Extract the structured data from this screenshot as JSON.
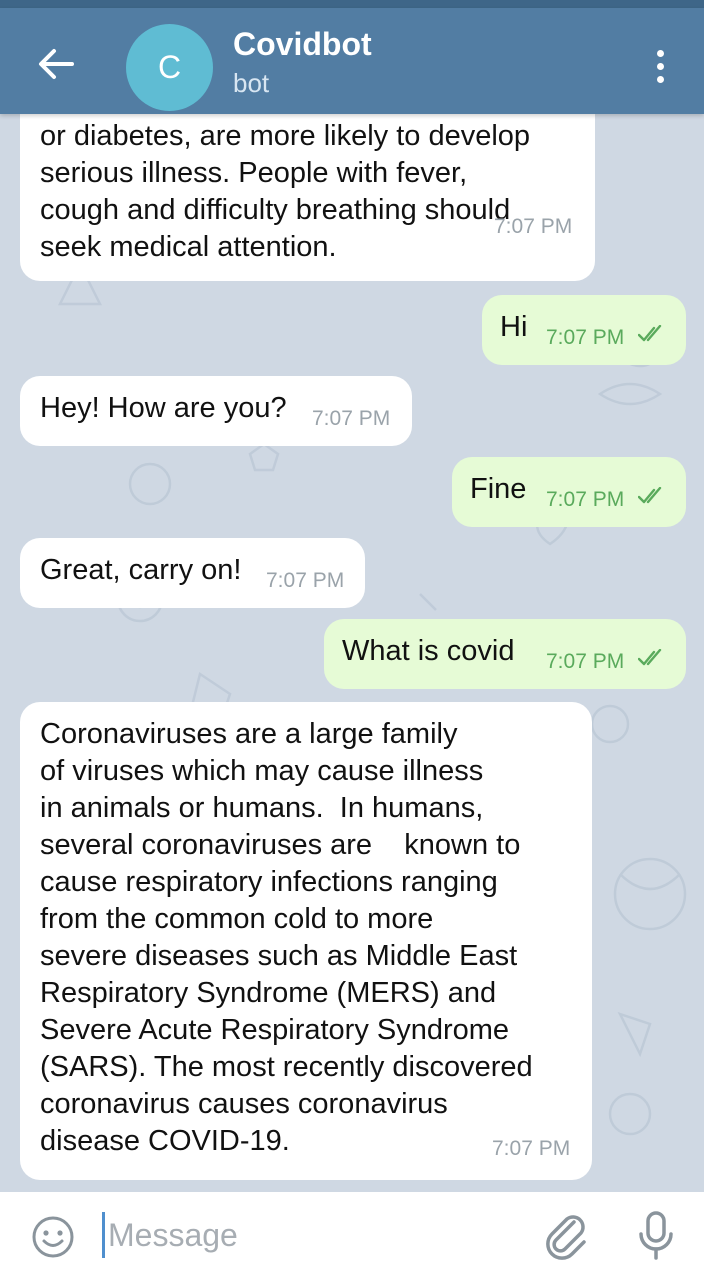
{
  "header": {
    "back_icon": "arrow-left-icon",
    "avatar_letter": "C",
    "avatar_color": "#5fbcd3",
    "title": "Covidbot",
    "subtitle": "bot",
    "menu_icon": "more-vertical-icon",
    "bar_color": "#527da3"
  },
  "messages": [
    {
      "direction": "in",
      "text": "or diabetes, are more likely to develop\nserious illness. People with fever,\ncough and difficulty breathing should\nseek medical attention.",
      "time": "7:07 PM"
    },
    {
      "direction": "out",
      "text": "Hi",
      "time": "7:07 PM",
      "read": true
    },
    {
      "direction": "in",
      "text": "Hey! How are you?",
      "time": "7:07 PM"
    },
    {
      "direction": "out",
      "text": "Fine",
      "time": "7:07 PM",
      "read": true
    },
    {
      "direction": "in",
      "text": "Great, carry on!",
      "time": "7:07 PM"
    },
    {
      "direction": "out",
      "text": "What is covid",
      "time": "7:07 PM",
      "read": true
    },
    {
      "direction": "in",
      "text": "Coronaviruses are a large family\nof viruses which may cause illness\nin animals or humans.  In humans,\nseveral coronaviruses are    known to\ncause respiratory infections ranging\nfrom the common cold to more\nsevere diseases such as Middle East\nRespiratory Syndrome (MERS) and\nSevere Acute Respiratory Syndrome\n(SARS). The most recently discovered\ncoronavirus causes coronavirus\ndisease COVID-19.",
      "time": "7:07 PM"
    }
  ],
  "composer": {
    "placeholder": "Message",
    "emoji_icon": "smiley-icon",
    "attach_icon": "paperclip-icon",
    "mic_icon": "microphone-icon"
  },
  "colors": {
    "incoming_bubble": "#ffffff",
    "outgoing_bubble": "#e6fbd6",
    "outgoing_time": "#5aaa5c",
    "chat_background": "#cfd8e3"
  }
}
